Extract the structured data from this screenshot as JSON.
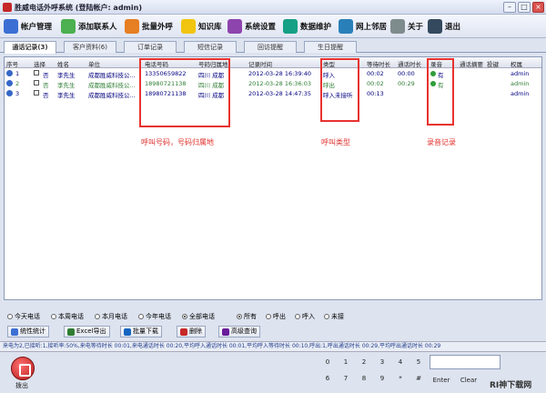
{
  "window": {
    "title": "胜威电话外呼系统 (登陆帐户: admin)"
  },
  "toolbar": [
    {
      "label": "帐户管理",
      "icon": "user-icon",
      "color": "#3b6fd4"
    },
    {
      "label": "添加联系人",
      "icon": "add-contact-icon",
      "color": "#4caf50"
    },
    {
      "label": "批量外呼",
      "icon": "batch-call-icon",
      "color": "#e67e22"
    },
    {
      "label": "知识库",
      "icon": "knowledge-icon",
      "color": "#f1c40f"
    },
    {
      "label": "系统设置",
      "icon": "tools-icon",
      "color": "#8e44ad"
    },
    {
      "label": "数据维护",
      "icon": "database-icon",
      "color": "#16a085"
    },
    {
      "label": "网上邻居",
      "icon": "network-icon",
      "color": "#2980b9"
    },
    {
      "label": "关于",
      "icon": "info-icon",
      "color": "#7f8c8d"
    },
    {
      "label": "退出",
      "icon": "exit-icon",
      "color": "#34495e"
    }
  ],
  "tabs": [
    "通话记录(3)",
    "客户资料(6)",
    "订单记录",
    "短信记录",
    "回访提醒",
    "生日提醒"
  ],
  "table": {
    "headers": [
      "序号",
      "选择",
      "姓名",
      "单位",
      "电话号码",
      "号码归属地",
      "记录时间",
      "类型",
      "等待时长",
      "通话时长",
      "录音",
      "通话摘要",
      "投键",
      "权属"
    ],
    "rows": [
      {
        "no": "1",
        "sel": "否",
        "name": "李先生",
        "company": "成都胜威科技公...",
        "phone": "13350659822",
        "loc": "四川 成都",
        "time": "2012-03-28 16:39:40",
        "type": "呼入",
        "wait": "00:02",
        "talk": "00:00",
        "rec": "有",
        "owner": "admin"
      },
      {
        "no": "2",
        "sel": "否",
        "name": "李先生",
        "company": "成都胜威科技公...",
        "phone": "18980721138",
        "loc": "四川 成都",
        "time": "2012-03-28 16:36:03",
        "type": "呼出",
        "wait": "00:02",
        "talk": "00:29",
        "rec": "有",
        "owner": "admin"
      },
      {
        "no": "3",
        "sel": "否",
        "name": "李先生",
        "company": "成都胜威科技公...",
        "phone": "18980721138",
        "loc": "四川 成都",
        "time": "2012-03-28 14:47:35",
        "type": "呼入未接听",
        "wait": "00:13",
        "talk": "",
        "rec": "",
        "owner": "admin"
      }
    ]
  },
  "annotations": {
    "a1": "呼叫号码，号码归属地",
    "a2": "呼叫类型",
    "a3": "录音记录"
  },
  "filters": {
    "period": [
      "今天电话",
      "本周电话",
      "本月电话",
      "今年电话",
      "全部电话"
    ],
    "direction": [
      "所有",
      "呼出",
      "呼入",
      "未接"
    ]
  },
  "actions": [
    "统性统计",
    "Excel导出",
    "批量下载",
    "删除",
    "高级查询"
  ],
  "status": "来电为2,已接听:1,接听率:50%,来电等待时长 00:01,来电通话时长 00:20,平均呼入通话时长 00:01,平均呼入等待时长 00:10,呼出:1,呼出通话时长 00:29,平均呼出通话时长 00:29",
  "dialer": {
    "dial_label": "拨出",
    "keys": [
      "0",
      "1",
      "2",
      "3",
      "4",
      "5",
      "6",
      "7",
      "8",
      "9",
      "*",
      "#"
    ],
    "enter": "Enter",
    "clear": "Clear"
  },
  "watermark": "RI神下载网"
}
